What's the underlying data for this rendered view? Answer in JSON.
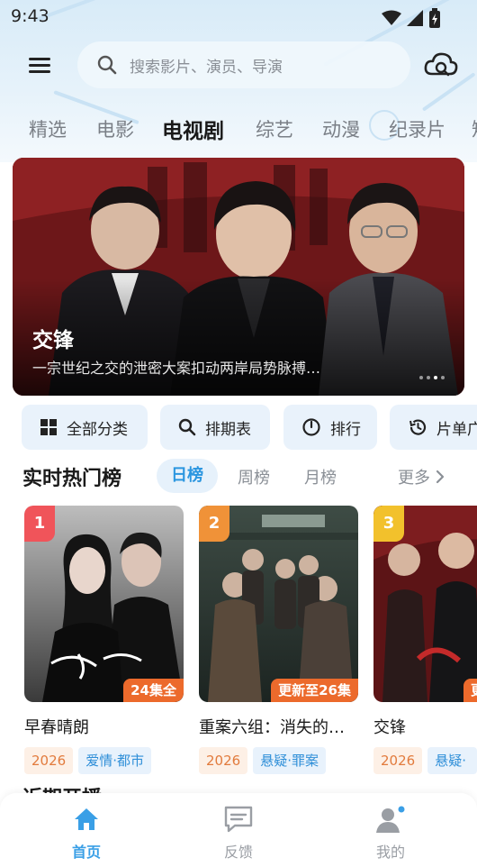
{
  "status_bar": {
    "time": "9:43"
  },
  "search": {
    "placeholder": "搜索影片、演员、导演"
  },
  "tabs": [
    {
      "label": "精选"
    },
    {
      "label": "电影"
    },
    {
      "label": "电视剧"
    },
    {
      "label": "综艺"
    },
    {
      "label": "动漫"
    },
    {
      "label": "纪录片"
    },
    {
      "label": "短"
    }
  ],
  "active_tab": "电视剧",
  "banner": {
    "title": "交锋",
    "subtitle": "一宗世纪之交的泄密大案扣动两岸局势脉搏…"
  },
  "quick_actions": [
    {
      "label": "全部分类",
      "icon": "grid-icon"
    },
    {
      "label": "排期表",
      "icon": "search-icon"
    },
    {
      "label": "排行",
      "icon": "clock-icon"
    },
    {
      "label": "片单广",
      "icon": "history-icon"
    }
  ],
  "ranking": {
    "title": "实时热门榜",
    "tabs": [
      "日榜",
      "周榜",
      "月榜"
    ],
    "active_tab": "日榜",
    "more_label": "更多",
    "items": [
      {
        "rank": "1",
        "title": "早春晴朗",
        "episodes": "24集全",
        "year": "2026",
        "genre": "爱情·都市",
        "badge_color": "#f0545a"
      },
      {
        "rank": "2",
        "title": "重案六组：消失的…",
        "episodes": "更新至26集",
        "year": "2026",
        "genre": "悬疑·罪案",
        "badge_color": "#f09238"
      },
      {
        "rank": "3",
        "title": "交锋",
        "episodes": "更",
        "year": "2026",
        "genre": "悬疑·谍",
        "badge_color": "#f2c12c"
      }
    ]
  },
  "next_section_title": "近期开播",
  "bottom_nav": [
    {
      "label": "首页",
      "icon": "home-icon"
    },
    {
      "label": "反馈",
      "icon": "feedback-icon"
    },
    {
      "label": "我的",
      "icon": "user-icon"
    }
  ],
  "colors": {
    "accent": "#3a9fe6",
    "episode_badge": "#ec6a2c",
    "year_tag_text": "#e27b3d",
    "genre_tag_text": "#2f8fd8"
  }
}
